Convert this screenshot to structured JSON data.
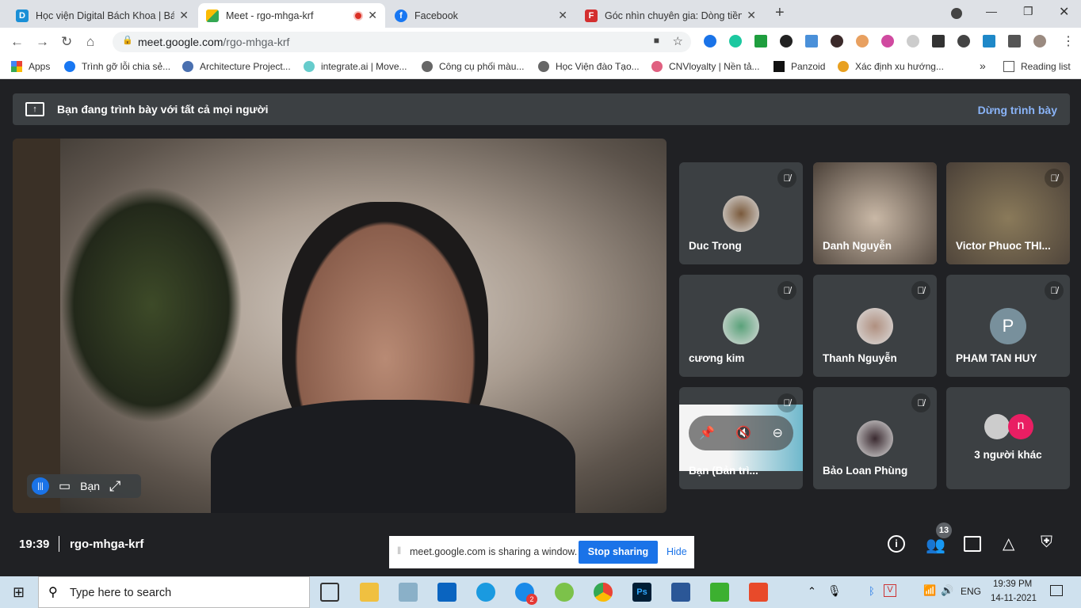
{
  "browser": {
    "tabs": [
      {
        "title": "Học viện Digital Bách Khoa | Bách",
        "icon": "D",
        "color": "#1a8fd6"
      },
      {
        "title": "Meet - rgo-mhga-krf",
        "icon": "meet-icon",
        "color": "#00897b",
        "active": true,
        "recording": true
      },
      {
        "title": "Facebook",
        "icon": "f",
        "color": "#1877f2"
      },
      {
        "title": "Góc nhìn chuyên gia: Dòng tiền c",
        "icon": "F",
        "color": "#d32f2f"
      }
    ],
    "url_host": "meet.google.com",
    "url_path": "/rgo-mhga-krf",
    "bookmarks": [
      "Apps",
      "Trình gỡ lỗi chia sẻ...",
      "Architecture Project...",
      "integrate.ai | Move...",
      "Công cụ phối màu...",
      "Học Viện đào Tạo...",
      "CNVloyalty | Nền tả...",
      "Panzoid",
      "Xác định xu hướng..."
    ],
    "more": "»",
    "reading_list": "Reading list"
  },
  "meet": {
    "banner_text": "Bạn đang trình bày với tất cả mọi người",
    "stop_presenting": "Dừng trình bày",
    "self_label": "Bạn",
    "participants": [
      {
        "name": "Duc Trong",
        "type": "avatar",
        "color": "#7a5a3c",
        "muted": true
      },
      {
        "name": "Danh Nguyễn",
        "type": "video",
        "color": "#c9b8a6",
        "muted": false
      },
      {
        "name": "Victor Phuoc THI...",
        "type": "video",
        "color": "#8a7a5a",
        "muted": true
      },
      {
        "name": "cương kim",
        "type": "avatar",
        "color": "#5aa27a",
        "muted": true
      },
      {
        "name": "Thanh Nguyễn",
        "type": "avatar",
        "color": "#b09080",
        "muted": true
      },
      {
        "name": "PHAM TAN HUY",
        "type": "letter",
        "letter": "P",
        "color": "#78909c",
        "muted": true
      },
      {
        "name": "Bạn (Bản trì...",
        "type": "presentation",
        "color": "#6fb8cc",
        "muted": true
      },
      {
        "name": "Bảo Loan Phùng",
        "type": "avatar",
        "color": "#3a2a30",
        "muted": true
      },
      {
        "name": "3 người khác",
        "type": "others",
        "letter": "n",
        "color": "#e91e63"
      }
    ],
    "time": "19:39",
    "meeting_code": "rgo-mhga-krf",
    "people_count": "13",
    "share_notice": {
      "text": "meet.google.com is sharing a window.",
      "stop": "Stop sharing",
      "hide": "Hide"
    }
  },
  "taskbar": {
    "search_placeholder": "Type here to search",
    "lang": "ENG",
    "time": "19:39 PM",
    "date": "14-11-2021",
    "zalo_badge": "2"
  }
}
